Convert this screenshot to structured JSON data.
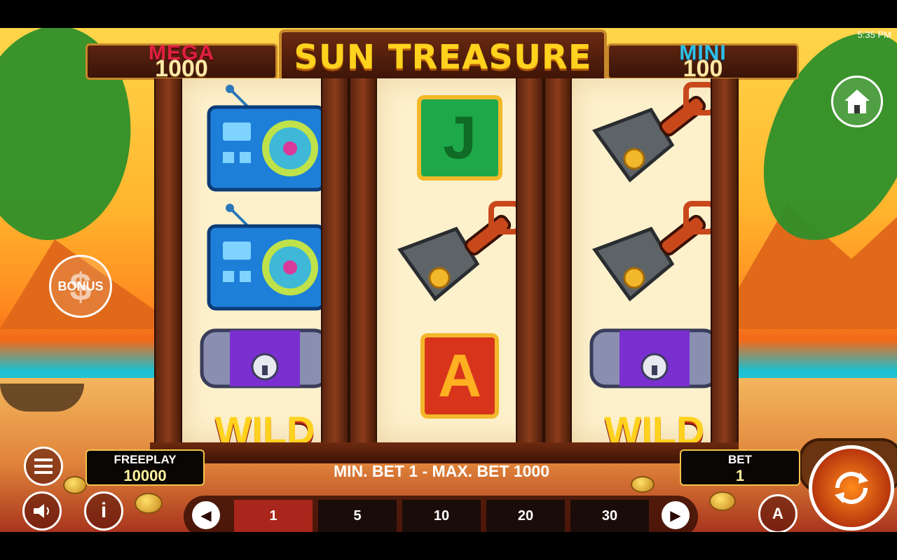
{
  "status_bar": {
    "time": "5:35 PM"
  },
  "game": {
    "title": "SUN TREASURE"
  },
  "jackpots": {
    "mega": {
      "label": "MEGA",
      "value": "1000"
    },
    "mini": {
      "label": "MINI",
      "value": "100"
    }
  },
  "bonus_button": {
    "label": "BONUS",
    "icon": "dollar-icon"
  },
  "reels": [
    {
      "symbols": [
        "radio",
        "radio",
        "wild-chest"
      ]
    },
    {
      "symbols": [
        "J",
        "shovel",
        "A"
      ]
    },
    {
      "symbols": [
        "shovel",
        "shovel",
        "wild-chest"
      ]
    }
  ],
  "symbol_text": {
    "wild": "WILD",
    "j": "J",
    "a": "A"
  },
  "panel": {
    "freeplay_label": "FREEPLAY",
    "freeplay_value": "10000",
    "bet_range": "MIN. BET 1 - MAX. BET 1000",
    "bet_label": "BET",
    "bet_value": "1",
    "bet_options": [
      "1",
      "5",
      "10",
      "20",
      "30"
    ],
    "selected_bet": "1",
    "auto_label": "A",
    "spin_icon": "spin-icon",
    "home_icon": "home-icon",
    "menu_icon": "menu-icon",
    "sound_icon": "sound-icon",
    "info_icon": "info-icon"
  },
  "colors": {
    "mega": "#e02040",
    "mini": "#2ec0ea",
    "logo": "#ffd21e",
    "active_bet": "#a8261c",
    "accent_gold": "#f3c24a"
  }
}
